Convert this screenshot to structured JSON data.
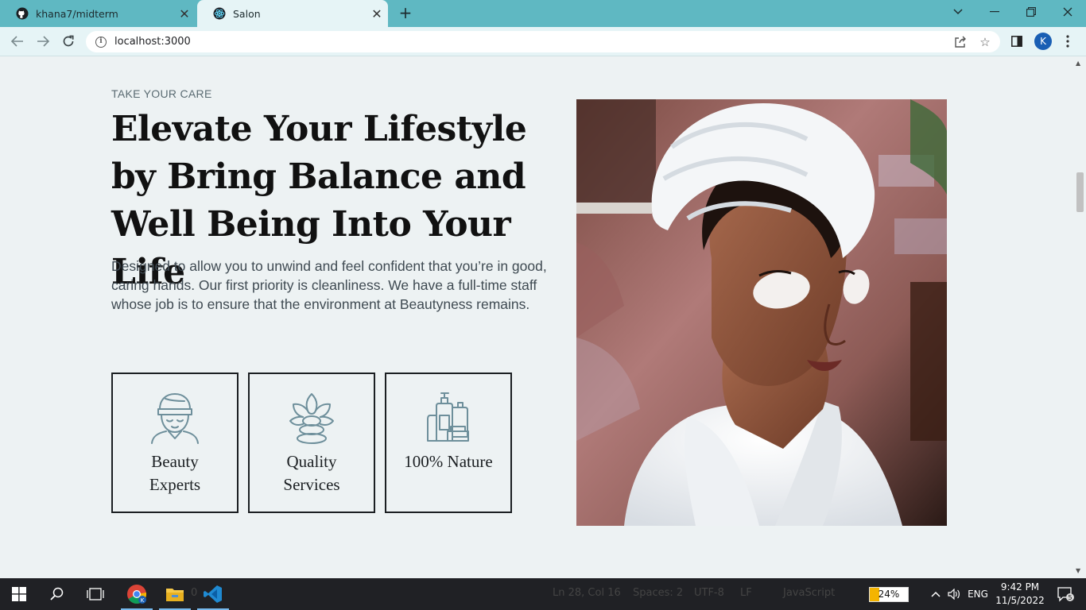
{
  "browser": {
    "tabs": [
      {
        "title": "khana7/midterm",
        "favicon": "github-icon"
      },
      {
        "title": "Salon",
        "favicon": "react-icon"
      }
    ],
    "url": "localhost:3000",
    "profile_initial": "K"
  },
  "hero_section": {
    "eyebrow": "TAKE YOUR CARE",
    "headline": "Elevate Your Lifestyle by Bring Balance and Well Being Into Your Life",
    "description": "Designed to allow you to unwind and feel confident that you’re in good, caring hands. Our first priority is cleanliness. We have a full-time staff whose job is to ensure that the environment at Beautyness remains.",
    "features": [
      {
        "label": "Beauty Experts",
        "icon": "face-towel-icon"
      },
      {
        "label": "Quality Services",
        "icon": "lotus-stones-icon"
      },
      {
        "label": "100% Nature",
        "icon": "cosmetics-bottles-icon"
      }
    ],
    "image": "woman-with-towel-and-eye-patches"
  },
  "taskbar": {
    "status_items": [
      "Ln 28, Col 16",
      "Spaces: 2",
      "UTF-8",
      "LF",
      "JavaScript"
    ],
    "badge_count": "0",
    "battery_percent": "24%",
    "language": "ENG",
    "time": "9:42 PM",
    "date": "11/5/2022",
    "notification_count": "5"
  },
  "colors": {
    "tabstrip": "#5fb8c2",
    "toolbar": "#e6f4f6",
    "page_bg": "#edf2f3",
    "icon_stroke": "#6e8f9b",
    "taskbar": "#202125"
  }
}
